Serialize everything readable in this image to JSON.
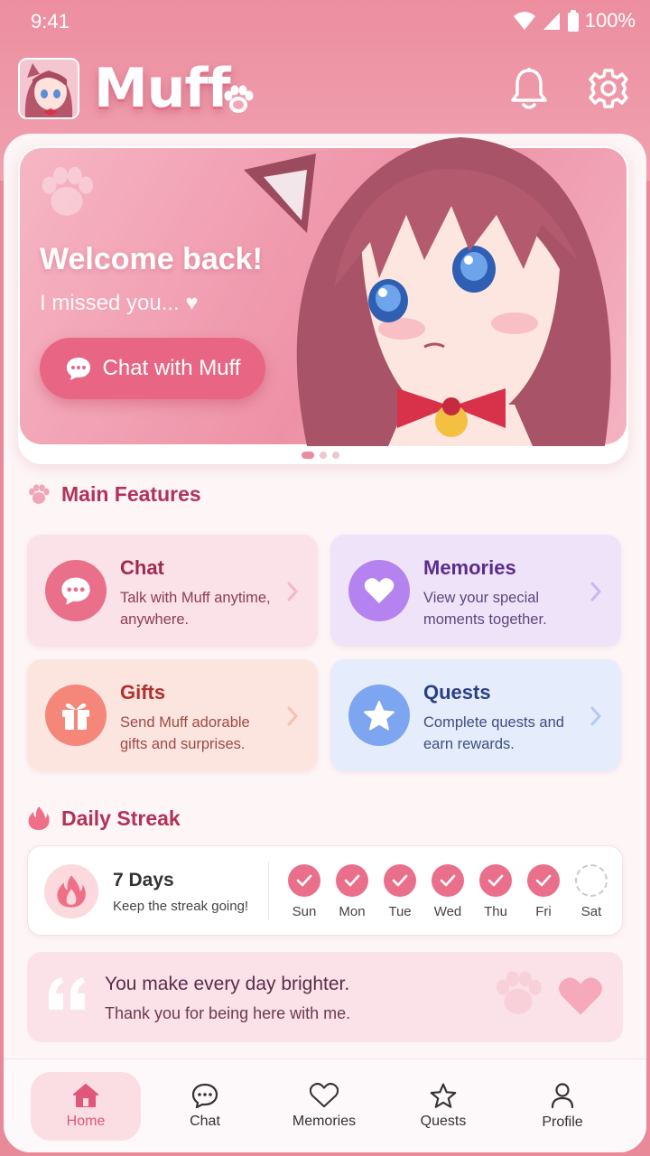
{
  "status": {
    "time": "9:41",
    "battery": "100%"
  },
  "header": {
    "logo_text": "Muff"
  },
  "hero": {
    "title": "Welcome back!",
    "subtitle": "I missed you... ♥",
    "cta_label": "Chat with Muff",
    "carousel_pages": 3,
    "carousel_active": 1
  },
  "features": {
    "title": "Main Features",
    "cards": [
      {
        "title": "Chat",
        "desc": "Talk with Muff anytime, anywhere."
      },
      {
        "title": "Memories",
        "desc": "View your special moments together."
      },
      {
        "title": "Gifts",
        "desc": "Send Muff adorable gifts and surprises."
      },
      {
        "title": "Quests",
        "desc": "Complete quests and earn rewards."
      }
    ]
  },
  "streak": {
    "title": "Daily Streak",
    "days_label": "7 Days",
    "subtitle": "Keep the streak going!",
    "days": [
      {
        "label": "Sun",
        "done": true
      },
      {
        "label": "Mon",
        "done": true
      },
      {
        "label": "Tue",
        "done": true
      },
      {
        "label": "Wed",
        "done": true
      },
      {
        "label": "Thu",
        "done": true
      },
      {
        "label": "Fri",
        "done": true
      },
      {
        "label": "Sat",
        "done": false
      }
    ]
  },
  "quote": {
    "line1": "You make every day brighter.",
    "line2": "Thank you for being here with me."
  },
  "nav": {
    "items": [
      {
        "label": "Home",
        "icon": "home-icon",
        "active": true
      },
      {
        "label": "Chat",
        "icon": "chat-icon",
        "active": false
      },
      {
        "label": "Memories",
        "icon": "heart-icon",
        "active": false
      },
      {
        "label": "Quests",
        "icon": "star-icon",
        "active": false
      },
      {
        "label": "Profile",
        "icon": "person-icon",
        "active": false
      }
    ]
  },
  "colors": {
    "accent": "#e86683",
    "brand_pink": "#ec8ea0",
    "title_red": "#b23258"
  }
}
